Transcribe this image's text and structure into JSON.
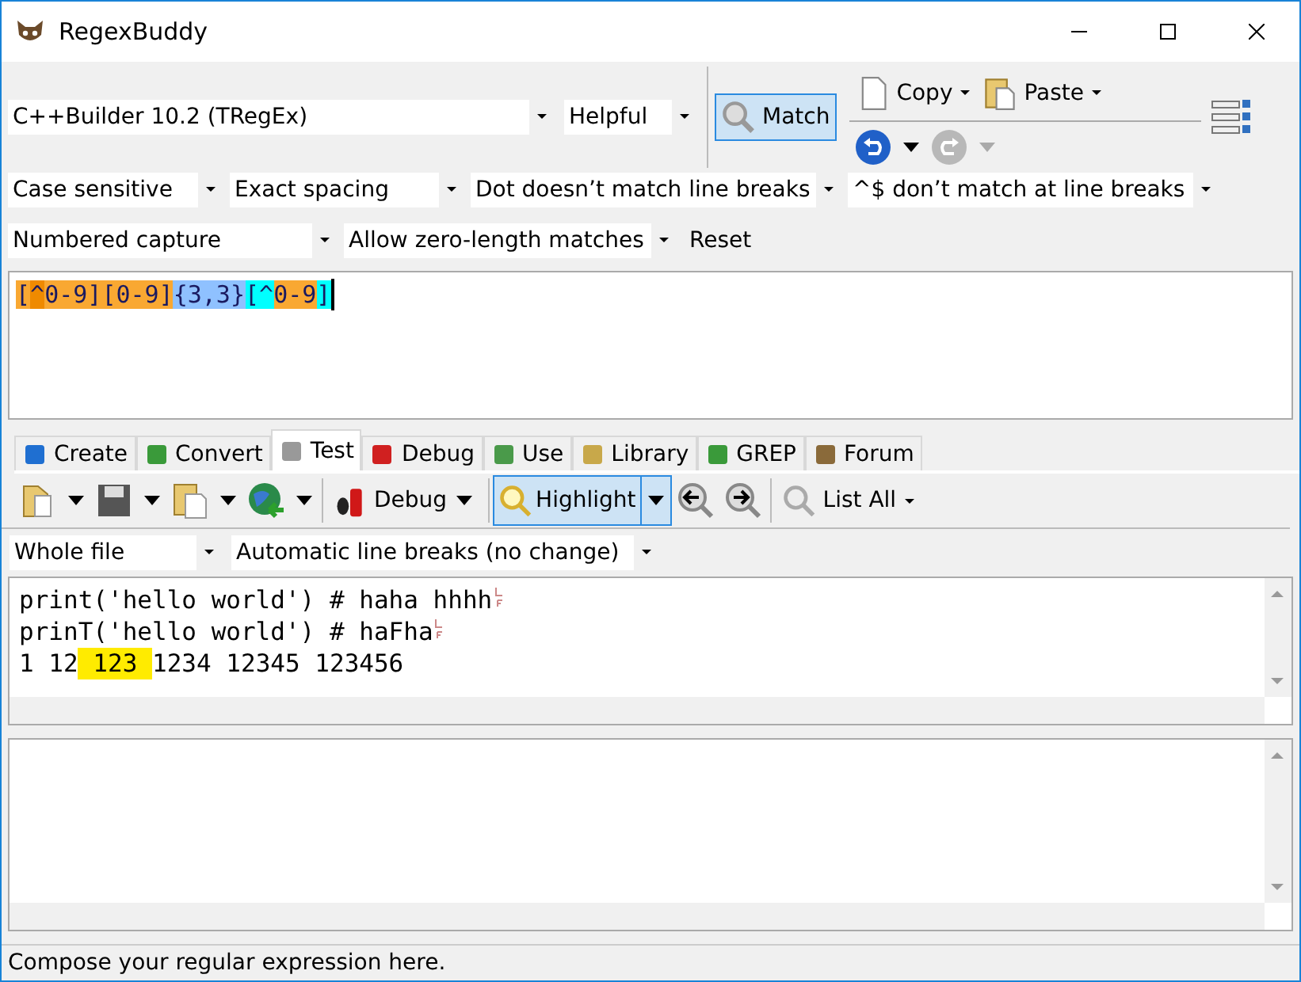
{
  "window": {
    "title": "RegexBuddy"
  },
  "toolbar": {
    "flavor": "C++Builder 10.2 (TRegEx)",
    "helpfulness": "Helpful",
    "match_button": "Match",
    "copy_button": "Copy",
    "paste_button": "Paste"
  },
  "options": [
    {
      "value": "Case sensitive"
    },
    {
      "value": "Exact spacing"
    },
    {
      "value": "Dot doesn’t match line breaks"
    },
    {
      "value": "^$ don’t match at line breaks"
    },
    {
      "value": "Numbered capture"
    },
    {
      "value": "Allow zero-length matches"
    }
  ],
  "reset_button": "Reset",
  "regex_tokens": [
    {
      "text": "[",
      "color": "#f9a832"
    },
    {
      "text": "^",
      "color": "#ef8a00"
    },
    {
      "text": "0-9]",
      "color": "#f9a832"
    },
    {
      "text": "[0-9]",
      "color": "#f9a832"
    },
    {
      "text": "{3,3}",
      "color": "#8fc1ff"
    },
    {
      "text": "[^",
      "color": "#00ffff"
    },
    {
      "text": "0-9",
      "color": "#f9a832"
    },
    {
      "text": "]",
      "color": "#00ffff"
    }
  ],
  "tabs": [
    {
      "label": "Create",
      "selected": false
    },
    {
      "label": "Convert",
      "selected": false
    },
    {
      "label": "Test",
      "selected": true
    },
    {
      "label": "Debug",
      "selected": false
    },
    {
      "label": "Use",
      "selected": false
    },
    {
      "label": "Library",
      "selected": false
    },
    {
      "label": "GREP",
      "selected": false
    },
    {
      "label": "Forum",
      "selected": false
    }
  ],
  "test_toolbar": {
    "debug_button": "Debug",
    "highlight_button": "Highlight",
    "highlight_on": true,
    "list_all_button": "List All"
  },
  "scope": "Whole file",
  "line_breaks": "Automatic line breaks (no change)",
  "test_lines": [
    {
      "segments": [
        {
          "text": "print('hello world') # haha hhhh",
          "highlighted": false
        }
      ],
      "line_break_mark": true
    },
    {
      "segments": [
        {
          "text": "prinT('hello world') # haFha",
          "highlighted": false
        }
      ],
      "line_break_mark": true
    },
    {
      "segments": [
        {
          "text": "1 12",
          "highlighted": false
        },
        {
          "text": " 123 ",
          "highlighted": true
        },
        {
          "text": "1234 12345 123456",
          "highlighted": false
        }
      ],
      "line_break_mark": false
    }
  ],
  "status_bar": "Compose your regular expression here."
}
